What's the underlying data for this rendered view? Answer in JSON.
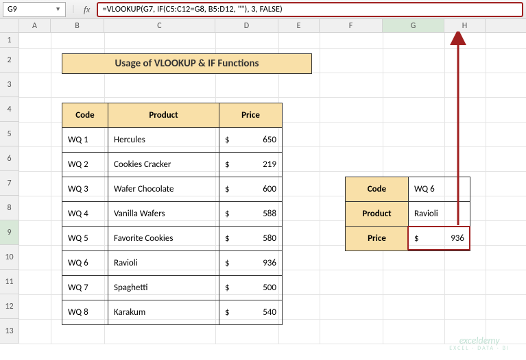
{
  "name_box": "G9",
  "formula": "=VLOOKUP(G7, IF(C5:C12=G8, B5:D12, \"\"), 3, FALSE)",
  "title": "Usage of VLOOKUP & IF Functions",
  "columns": [
    "A",
    "B",
    "C",
    "D",
    "E",
    "F",
    "G",
    "H"
  ],
  "rows": [
    "1",
    "2",
    "3",
    "4",
    "5",
    "6",
    "7",
    "8",
    "9",
    "10",
    "11",
    "12",
    "13"
  ],
  "headers": {
    "code": "Code",
    "product": "Product",
    "price": "Price"
  },
  "data": [
    {
      "code": "WQ 1",
      "product": "Hercules",
      "price": "650"
    },
    {
      "code": "WQ 2",
      "product": "Cookies Cracker",
      "price": "219"
    },
    {
      "code": "WQ 3",
      "product": "Wafer Chocolate",
      "price": "600"
    },
    {
      "code": "WQ 4",
      "product": "Vanilla Wafers",
      "price": "588"
    },
    {
      "code": "WQ 5",
      "product": "Favorite Cookies",
      "price": "580"
    },
    {
      "code": "WQ 6",
      "product": "Ravioli",
      "price": "936"
    },
    {
      "code": "WQ 7",
      "product": "Spaghetti",
      "price": "500"
    },
    {
      "code": "WQ 8",
      "product": "Karakum",
      "price": "540"
    }
  ],
  "lookup": {
    "code_label": "Code",
    "code_value": "WQ 6",
    "product_label": "Product",
    "product_value": "Ravioli",
    "price_label": "Price",
    "price_value": "936"
  },
  "currency": "$",
  "watermark": {
    "main": "exceldemy",
    "sub": "EXCEL · DATA · BI"
  },
  "col_widths": {
    "A": 46,
    "B": 78,
    "C": 162,
    "D": 92,
    "E": 60,
    "F": 92,
    "G": 90,
    "H": 60
  }
}
